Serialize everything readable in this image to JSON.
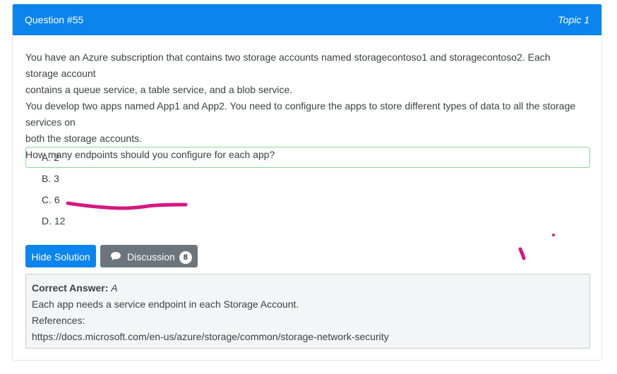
{
  "question": {
    "title": "Question #55",
    "topic": "Topic 1",
    "text": [
      "You have an Azure subscription that contains two storage accounts named storagecontoso1 and storagecontoso2. Each storage account",
      "contains a queue service, a table service, and a blob service.",
      "You develop two apps named App1 and App2. You need to configure the apps to store different types of data to all the storage services on",
      "both the storage accounts.",
      "How many endpoints should you configure for each app?"
    ],
    "choices": [
      "A. 2",
      "B. 3",
      "C. 6",
      "D. 12"
    ]
  },
  "buttons": {
    "hide_solution": "Hide Solution",
    "discussion": "Discussion",
    "discussion_count": "8"
  },
  "answer": {
    "label": "Correct Answer:",
    "value": "A",
    "explanation": "Each app needs a service endpoint in each Storage Account.",
    "references_label": "References:",
    "reference_url": "https://docs.microsoft.com/en-us/azure/storage/common/storage-network-security"
  },
  "colors": {
    "header": "#0b84ee",
    "secondary_button": "#6b757d",
    "correct_border": "#8bd59a",
    "annotation": "#d6187f"
  }
}
